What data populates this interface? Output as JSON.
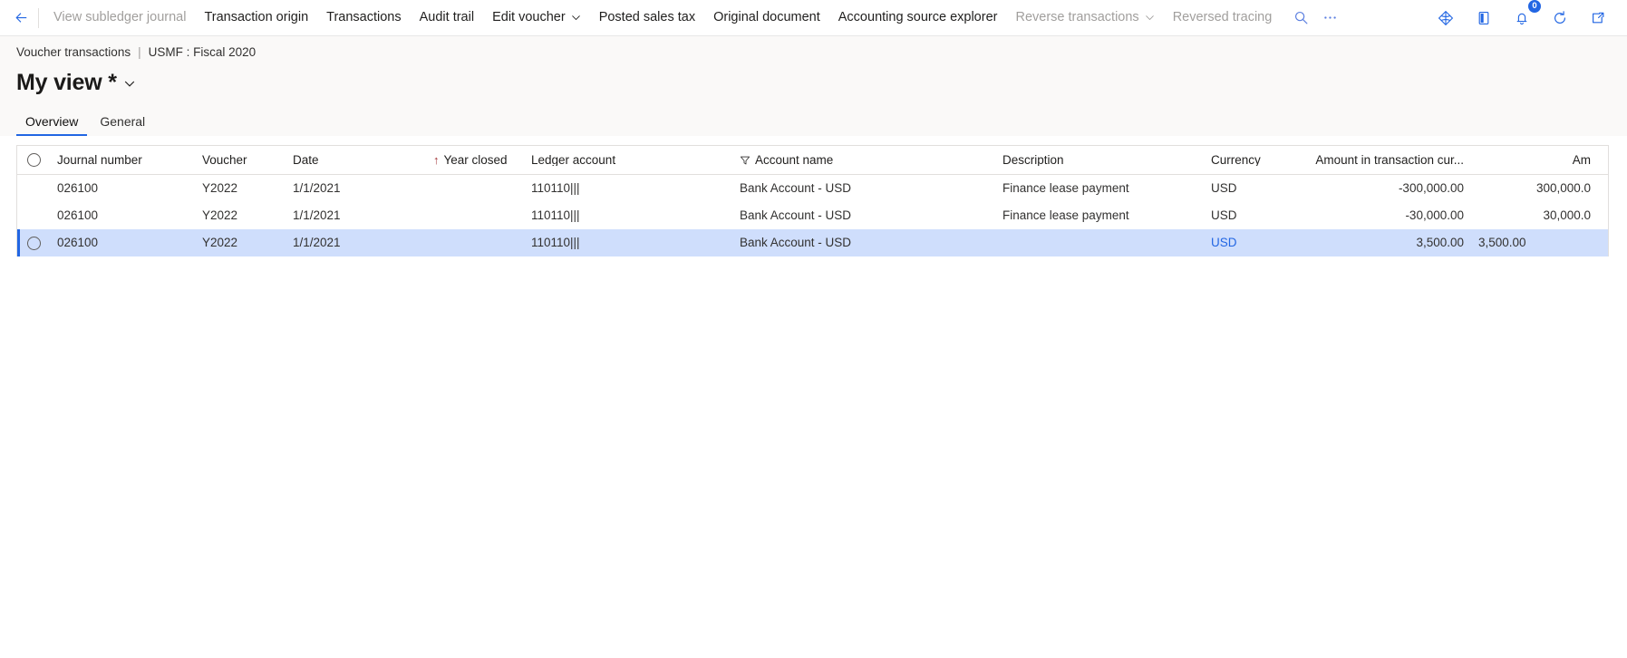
{
  "commandbar": {
    "back_icon": "back-arrow-icon",
    "items": [
      {
        "label": "View subledger journal",
        "disabled": true,
        "caret": false
      },
      {
        "label": "Transaction origin",
        "disabled": false,
        "caret": false
      },
      {
        "label": "Transactions",
        "disabled": false,
        "caret": false
      },
      {
        "label": "Audit trail",
        "disabled": false,
        "caret": false
      },
      {
        "label": "Edit voucher",
        "disabled": false,
        "caret": true
      },
      {
        "label": "Posted sales tax",
        "disabled": false,
        "caret": false
      },
      {
        "label": "Original document",
        "disabled": false,
        "caret": false
      },
      {
        "label": "Accounting source explorer",
        "disabled": false,
        "caret": false
      },
      {
        "label": "Reverse transactions",
        "disabled": true,
        "caret": true
      },
      {
        "label": "Reversed tracing",
        "disabled": true,
        "caret": false
      }
    ],
    "search_icon": "search-icon",
    "overflow_icon": "ellipsis-icon",
    "right_icons": [
      {
        "name": "diamond-office-icon"
      },
      {
        "name": "open-in-app-icon"
      },
      {
        "name": "notifications-icon",
        "badge": "0"
      },
      {
        "name": "refresh-icon"
      },
      {
        "name": "popout-window-icon"
      }
    ],
    "accent": "#2266e3"
  },
  "header": {
    "breadcrumb_page": "Voucher transactions",
    "breadcrumb_separator": "|",
    "breadcrumb_context": "USMF : Fiscal 2020",
    "view_title": "My view *",
    "view_caret_icon": "chevron-down-icon"
  },
  "tabs": [
    {
      "label": "Overview",
      "active": true
    },
    {
      "label": "General",
      "active": false
    }
  ],
  "grid": {
    "select_all_icon": "select-all-radio",
    "columns": [
      {
        "key": "journal_number",
        "label": "Journal number",
        "align": "left",
        "cls": "c-journal",
        "sort": null,
        "filter": false
      },
      {
        "key": "voucher",
        "label": "Voucher",
        "align": "left",
        "cls": "c-voucher",
        "sort": null,
        "filter": false
      },
      {
        "key": "date",
        "label": "Date",
        "align": "left",
        "cls": "c-date",
        "sort": null,
        "filter": false
      },
      {
        "key": "year_closed",
        "label": "Year closed",
        "align": "left",
        "cls": "c-yearclosed",
        "sort": "asc",
        "filter": false
      },
      {
        "key": "ledger_account",
        "label": "Ledger account",
        "align": "left",
        "cls": "c-ledger",
        "sort": null,
        "filter": false
      },
      {
        "key": "account_name",
        "label": "Account name",
        "align": "left",
        "cls": "c-accname",
        "sort": null,
        "filter": true
      },
      {
        "key": "description",
        "label": "Description",
        "align": "left",
        "cls": "c-desc",
        "sort": null,
        "filter": false
      },
      {
        "key": "currency",
        "label": "Currency",
        "align": "left",
        "cls": "c-currency",
        "sort": null,
        "filter": false
      },
      {
        "key": "amount_trans",
        "label": "Amount in transaction cur...",
        "align": "right",
        "cls": "c-amttrans",
        "sort": null,
        "filter": false
      },
      {
        "key": "amount_2",
        "label": "Am",
        "align": "right",
        "cls": "c-amt2",
        "sort": null,
        "filter": false
      }
    ],
    "column_menu_icon": "column-options-kebab-icon",
    "rows": [
      {
        "selected": false,
        "has_selector": false,
        "journal_number": "026100",
        "voucher": "Y2022",
        "date": "1/1/2021",
        "year_closed": "",
        "ledger_account": "110110|||",
        "account_name": "Bank Account - USD",
        "description": "Finance lease payment",
        "currency": "USD",
        "amount_trans": "-300,000.00",
        "amount_2": "300,000.0"
      },
      {
        "selected": false,
        "has_selector": false,
        "journal_number": "026100",
        "voucher": "Y2022",
        "date": "1/1/2021",
        "year_closed": "",
        "ledger_account": "110110|||",
        "account_name": "Bank Account - USD",
        "description": "Finance lease payment",
        "currency": "USD",
        "amount_trans": "-30,000.00",
        "amount_2": "30,000.0"
      },
      {
        "selected": true,
        "has_selector": true,
        "journal_number": "026100",
        "voucher": "Y2022",
        "date": "1/1/2021",
        "year_closed": "",
        "ledger_account": "110110|||",
        "account_name": "Bank Account - USD",
        "description": "",
        "currency": "USD",
        "amount_trans": "3,500.00",
        "amount_2": "3,500.00"
      }
    ],
    "selected_row_accent": "#2266e3",
    "selected_row_bg": "#cfdefc"
  }
}
